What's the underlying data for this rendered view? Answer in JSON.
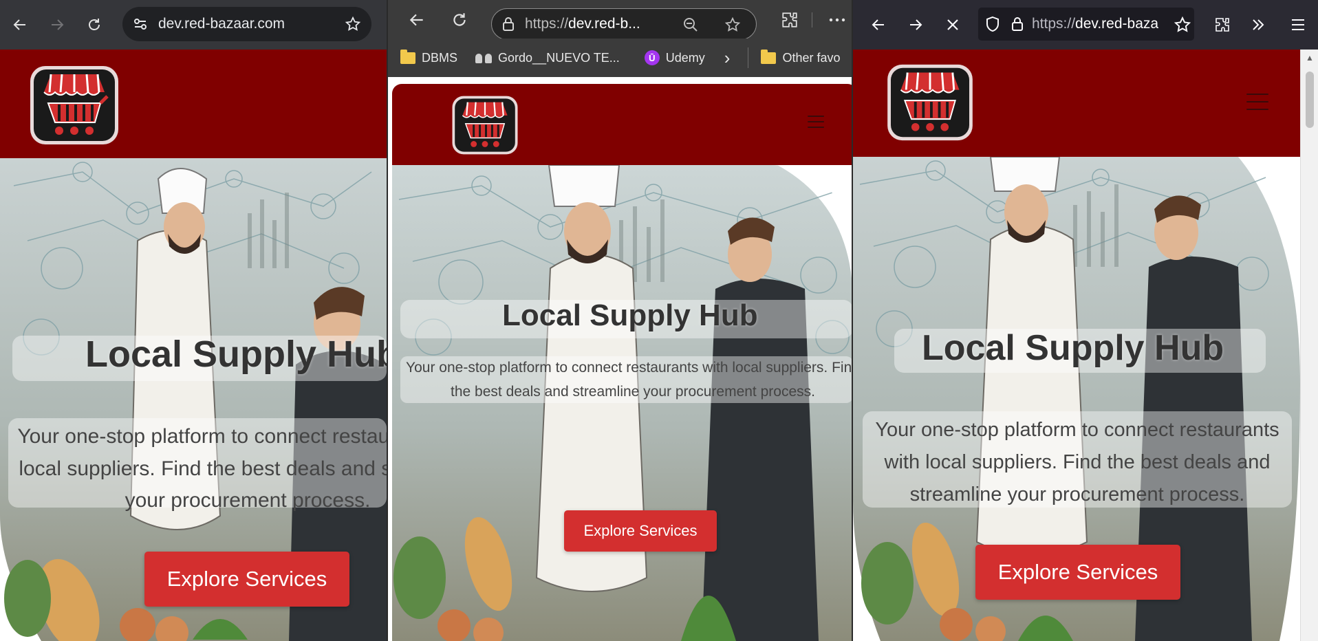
{
  "brand": {
    "header_color": "#800000",
    "cta_color": "#d32f2f"
  },
  "windows": [
    {
      "browser": "Chrome",
      "address": {
        "url": "dev.red-bazaar.com"
      },
      "icons": [
        "back-icon",
        "forward-icon",
        "reload-icon",
        "site-settings-icon",
        "bookmark-star-icon"
      ]
    },
    {
      "browser": "Edge",
      "address": {
        "url_prefix": "https://",
        "url_host": "dev.red-b..."
      },
      "bookmarks": [
        {
          "label": "DBMS",
          "icon": "folder-icon"
        },
        {
          "label": "Gordo__NUEVO TE...",
          "icon": "people-icon"
        },
        {
          "label": "Udemy",
          "icon": "udemy-icon"
        },
        {
          "label": "Other favo",
          "icon": "folder-icon"
        }
      ],
      "icons": [
        "back-icon",
        "reload-icon",
        "lock-icon",
        "zoom-icon",
        "favorite-star-icon",
        "extensions-icon",
        "more-icon"
      ]
    },
    {
      "browser": "Firefox",
      "address": {
        "url_prefix": "https://",
        "url_host": "dev.red-baza"
      },
      "icons": [
        "back-icon",
        "forward-icon",
        "stop-icon",
        "shield-icon",
        "lock-icon",
        "bookmark-star-icon",
        "extensions-icon",
        "overflow-icon",
        "menu-icon"
      ]
    }
  ],
  "page": {
    "hero": {
      "title": "Local Supply Hub",
      "subtitle": "Your one-stop platform to connect restaurants with local suppliers. Find the best deals and streamline your procurement process.",
      "cta_label": "Explore Services"
    }
  }
}
